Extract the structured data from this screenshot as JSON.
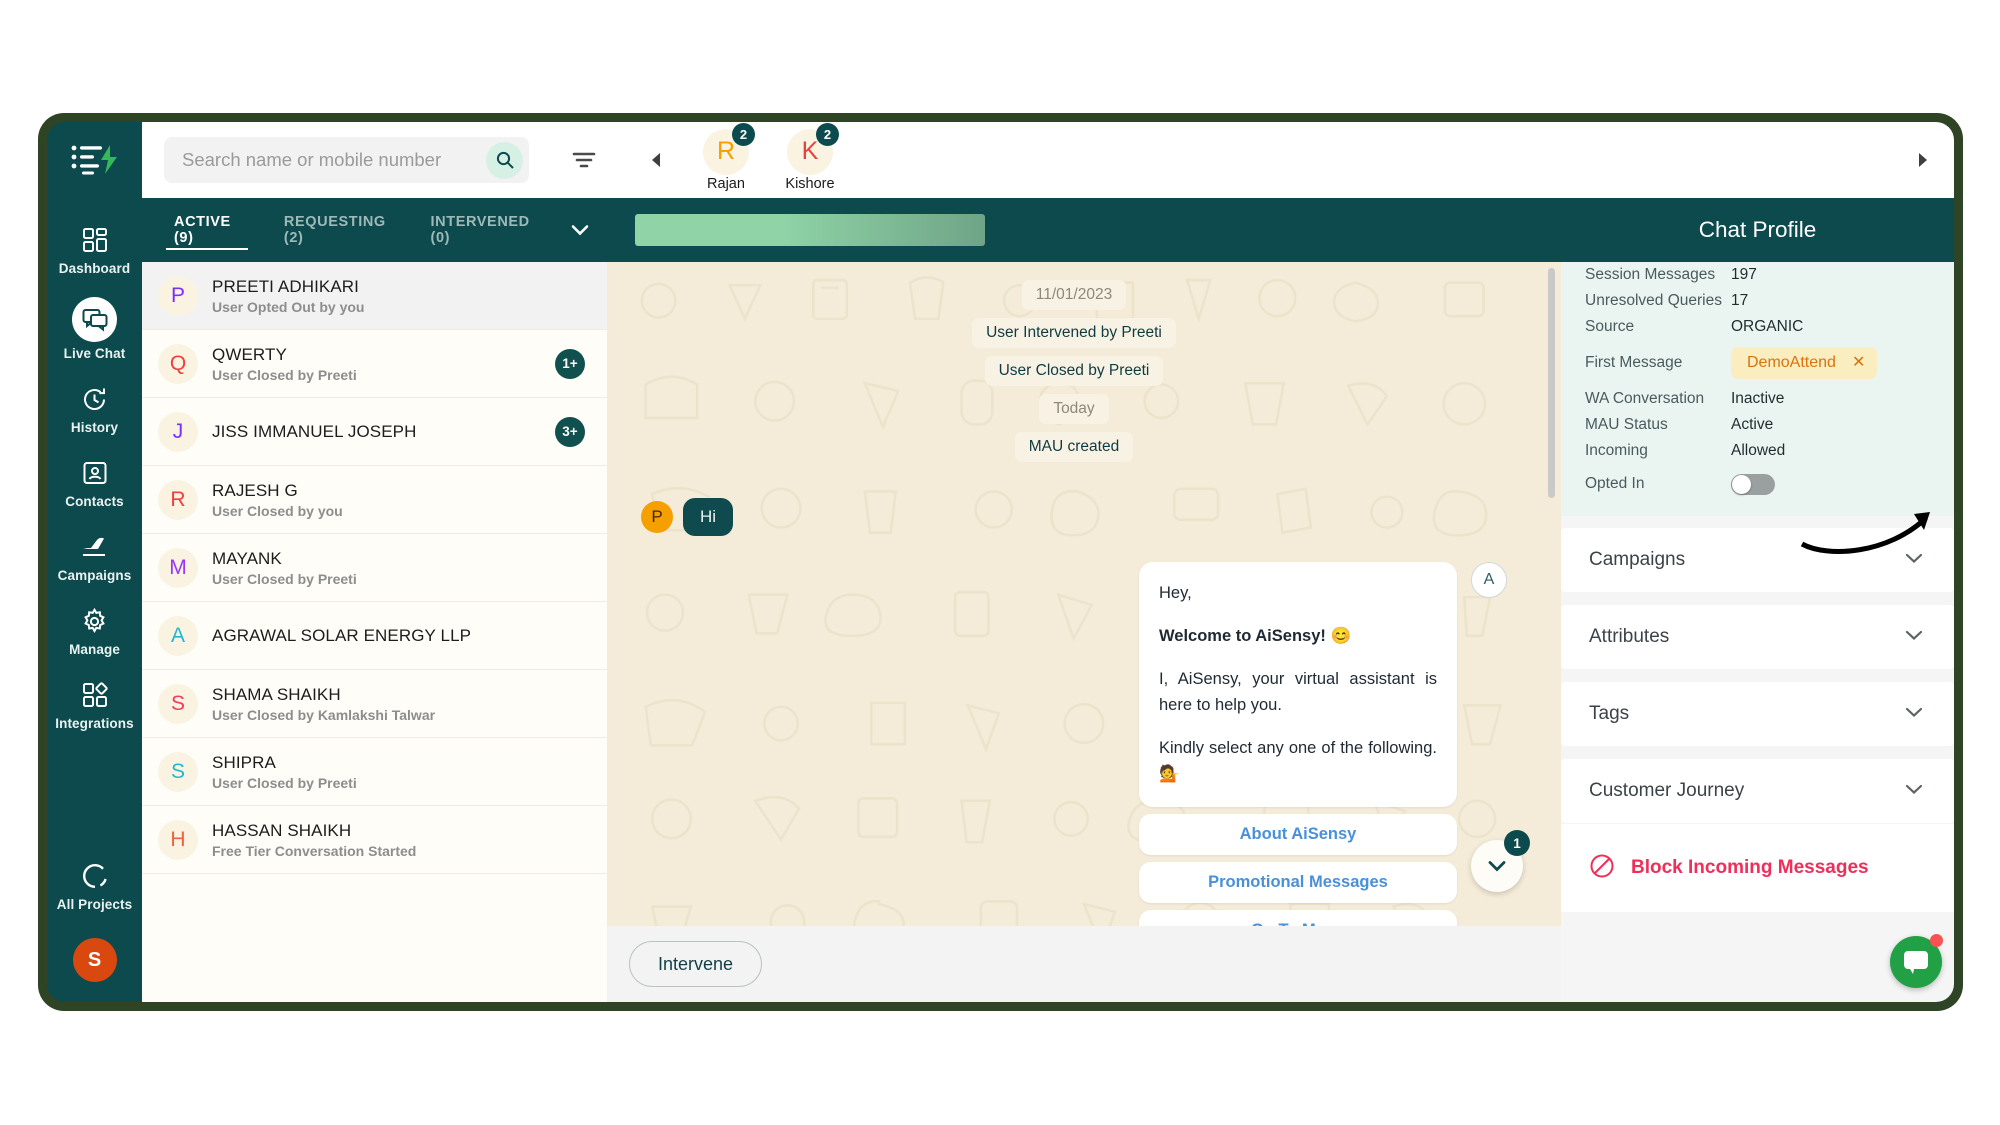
{
  "brand": {
    "logo_icon": "aisensy-logo-icon",
    "accent_teal": "#0d4a4d",
    "accent_green": "#22a046",
    "frame_color": "#2f4424"
  },
  "rail": {
    "items": [
      {
        "label": "Dashboard",
        "icon": "dashboard-grid-icon",
        "active": false
      },
      {
        "label": "Live Chat",
        "icon": "chat-bubbles-icon",
        "active": true
      },
      {
        "label": "History",
        "icon": "clock-history-icon",
        "active": false
      },
      {
        "label": "Contacts",
        "icon": "contact-card-icon",
        "active": false
      },
      {
        "label": "Campaigns",
        "icon": "paper-plane-icon",
        "active": false
      },
      {
        "label": "Manage",
        "icon": "gear-icon",
        "active": false
      },
      {
        "label": "Integrations",
        "icon": "integrations-icon",
        "active": false
      }
    ],
    "bottom": {
      "all_projects_label": "All Projects",
      "all_projects_icon": "projects-circle-icon",
      "avatar_initial": "S"
    }
  },
  "topbar": {
    "search_placeholder": "Search name or mobile number",
    "search_value": "",
    "search_icon": "search-icon",
    "filter_icon": "filter-icon",
    "collapse_icon": "chevron-left-icon",
    "expand_icon": "chevron-right-icon",
    "agents": [
      {
        "initial": "R",
        "name": "Rajan",
        "badge": "2",
        "initial_color": "#f59f00"
      },
      {
        "initial": "K",
        "name": "Kishore",
        "badge": "2",
        "initial_color": "#e8413c"
      }
    ]
  },
  "list": {
    "tabs": [
      {
        "label": "ACTIVE (9)",
        "active": true
      },
      {
        "label": "REQUESTING (2)",
        "active": false
      },
      {
        "label": "INTERVENED (0)",
        "active": false
      }
    ],
    "tabs_more_icon": "chevron-down-icon",
    "items": [
      {
        "initial": "P",
        "color": "#7b2ff7",
        "name": "PREETI ADHIKARI",
        "sub": "User Opted Out by you",
        "badge": "",
        "selected": true
      },
      {
        "initial": "Q",
        "color": "#f03e3e",
        "name": "QWERTY",
        "sub": "User Closed by Preeti",
        "badge": "1+",
        "selected": false
      },
      {
        "initial": "J",
        "color": "#7b2ff7",
        "name": "JISS IMMANUEL JOSEPH",
        "sub": "",
        "badge": "3+",
        "selected": false
      },
      {
        "initial": "R",
        "color": "#f03e3e",
        "name": "RAJESH G",
        "sub": "User Closed by you",
        "badge": "",
        "selected": false
      },
      {
        "initial": "M",
        "color": "#9c36f5",
        "name": "MAYANK",
        "sub": "User Closed by Preeti",
        "badge": "",
        "selected": false
      },
      {
        "initial": "A",
        "color": "#22b8cf",
        "name": "AGRAWAL SOLAR ENERGY LLP",
        "sub": "",
        "badge": "",
        "selected": false
      },
      {
        "initial": "S",
        "color": "#f03e5a",
        "name": "SHAMA SHAIKH",
        "sub": "User Closed by Kamlakshi Talwar",
        "badge": "",
        "selected": false
      },
      {
        "initial": "S",
        "color": "#22b8cf",
        "name": "SHIPRA",
        "sub": "User Closed by Preeti",
        "badge": "",
        "selected": false
      },
      {
        "initial": "H",
        "color": "#f0603e",
        "name": "HASSAN SHAIKH",
        "sub": "Free Tier Conversation Started",
        "badge": "",
        "selected": false
      }
    ]
  },
  "conversation": {
    "system_messages": [
      {
        "text": "11/01/2023",
        "kind": "date"
      },
      {
        "text": "User Intervened by Preeti",
        "kind": "event"
      },
      {
        "text": "User Closed by Preeti",
        "kind": "event"
      },
      {
        "text": "Today",
        "kind": "date"
      },
      {
        "text": "MAU created",
        "kind": "event"
      }
    ],
    "incoming": {
      "avatar_initial": "P",
      "text": "Hi"
    },
    "outgoing": {
      "avatar_initial": "A",
      "lines": [
        {
          "text": "Hey,",
          "bold": false
        },
        {
          "text": "Welcome to AiSensy! 😊",
          "bold": true
        },
        {
          "text": "I, AiSensy, your virtual assistant is here to help you.",
          "bold": false
        },
        {
          "text": "Kindly select any one of the following. 💁",
          "bold": false
        }
      ],
      "buttons": [
        "About AiSensy",
        "Promotional Messages",
        "Go To Menu"
      ]
    },
    "scroll_fab_icon": "chevron-down-icon",
    "scroll_fab_badge": "1",
    "composer_button": "Intervene"
  },
  "profile": {
    "title": "Chat Profile",
    "info": [
      {
        "label": "Session Messages",
        "value": "197",
        "type": "text"
      },
      {
        "label": "Unresolved Queries",
        "value": "17",
        "type": "text"
      },
      {
        "label": "Source",
        "value": "ORGANIC",
        "type": "text"
      },
      {
        "label": "First Message",
        "value": "DemoAttend",
        "type": "tag"
      },
      {
        "label": "WA Conversation",
        "value": "Inactive",
        "type": "text"
      },
      {
        "label": "MAU Status",
        "value": "Active",
        "type": "text"
      },
      {
        "label": "Incoming",
        "value": "Allowed",
        "type": "text"
      },
      {
        "label": "Opted In",
        "value": "off",
        "type": "toggle"
      }
    ],
    "tag_remove_icon": "close-icon",
    "accordions": [
      {
        "title": "Campaigns",
        "icon": "chevron-down-icon"
      },
      {
        "title": "Attributes",
        "icon": "chevron-down-icon"
      },
      {
        "title": "Tags",
        "icon": "chevron-down-icon"
      },
      {
        "title": "Customer Journey",
        "icon": "chevron-down-icon"
      }
    ],
    "block": {
      "label": "Block Incoming Messages",
      "icon": "block-circle-icon"
    },
    "support_widget_icon": "intercom-chat-icon"
  }
}
